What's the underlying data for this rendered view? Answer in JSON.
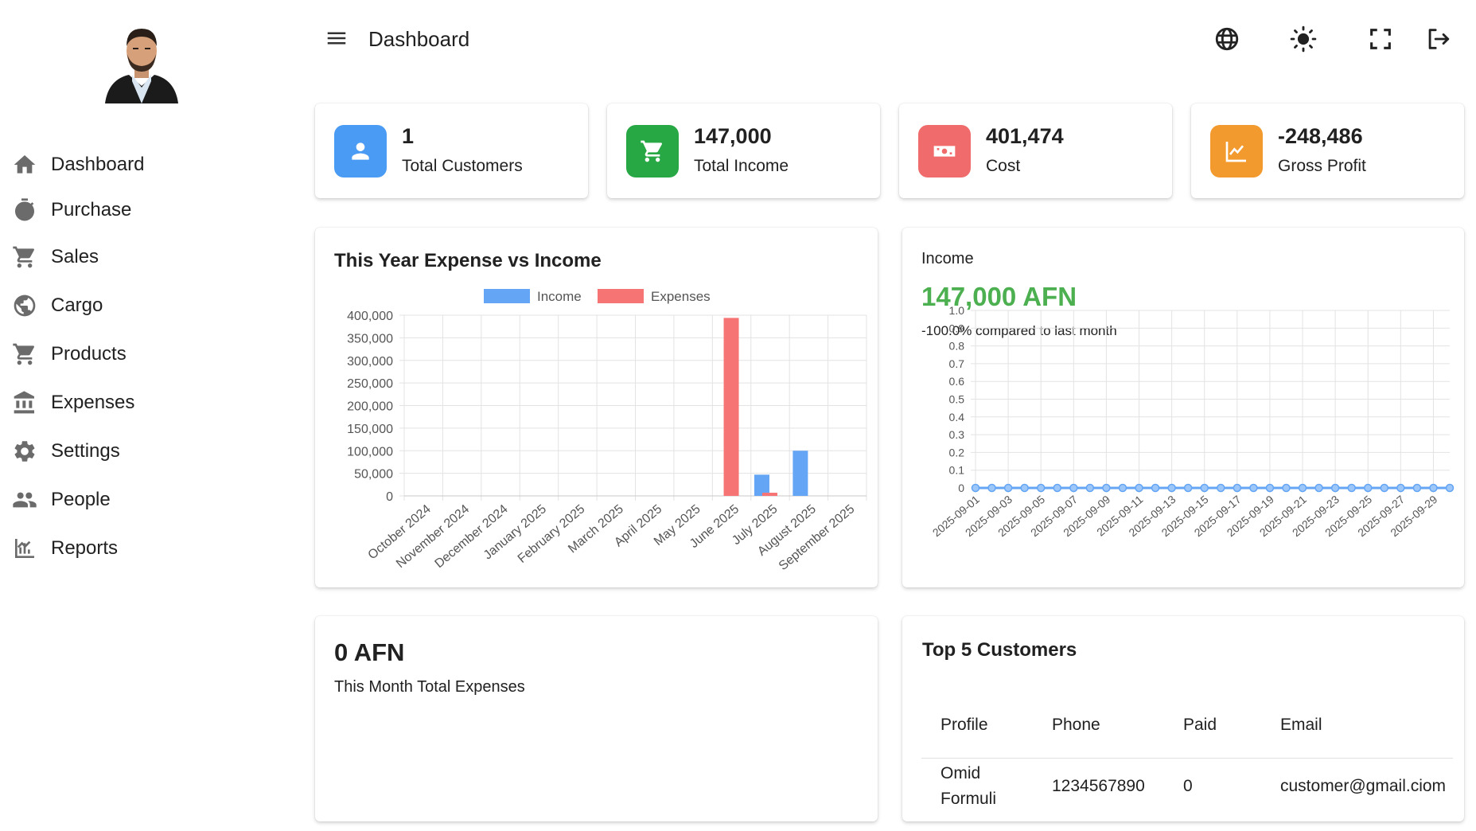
{
  "app": {
    "title": "Dashboard"
  },
  "sidebar": {
    "items": [
      {
        "label": "Dashboard",
        "icon": "home-icon"
      },
      {
        "label": "Purchase",
        "icon": "timer-icon"
      },
      {
        "label": "Sales",
        "icon": "cart-icon"
      },
      {
        "label": "Cargo",
        "icon": "globe-icon"
      },
      {
        "label": "Products",
        "icon": "cart-icon"
      },
      {
        "label": "Expenses",
        "icon": "bank-icon"
      },
      {
        "label": "Settings",
        "icon": "gear-icon"
      },
      {
        "label": "People",
        "icon": "people-icon"
      },
      {
        "label": "Reports",
        "icon": "chart-icon"
      }
    ]
  },
  "header": {
    "title": "Dashboard",
    "icons": [
      "language-icon",
      "theme-icon",
      "fullscreen-icon",
      "logout-icon"
    ]
  },
  "stats": [
    {
      "value": "1",
      "label": "Total Customers",
      "color": "#4a9bf3",
      "icon": "user-icon"
    },
    {
      "value": "147,000",
      "label": "Total Income",
      "color": "#28a745",
      "icon": "cart-icon"
    },
    {
      "value": "401,474",
      "label": "Cost",
      "color": "#f06b6b",
      "icon": "money-icon"
    },
    {
      "value": "-248,486",
      "label": "Gross Profit",
      "color": "#f39a2e",
      "icon": "trend-icon"
    }
  ],
  "expense_chart": {
    "title": "This Year Expense vs Income"
  },
  "income_panel": {
    "caption": "Income",
    "amount": "147,000 AFN",
    "compare": "-100.0% compared to last month"
  },
  "expenses_panel": {
    "amount": "0 AFN",
    "label": "This Month Total Expenses"
  },
  "customers": {
    "title": "Top 5 Customers",
    "columns": [
      "Profile",
      "Phone",
      "Paid",
      "Email"
    ],
    "rows": [
      {
        "profile_line1": "Omid",
        "profile_line2": "Formuli",
        "phone": "1234567890",
        "paid": "0",
        "email": "customer@gmail.ciom"
      }
    ]
  },
  "chart_data": [
    {
      "type": "bar",
      "title": "This Year Expense vs Income",
      "categories": [
        "October 2024",
        "November 2024",
        "December 2024",
        "January 2025",
        "February 2025",
        "March 2025",
        "April 2025",
        "May 2025",
        "June 2025",
        "July 2025",
        "August 2025",
        "September 2025"
      ],
      "series": [
        {
          "name": "Income",
          "color": "#64a5f5",
          "values": [
            0,
            0,
            0,
            0,
            0,
            0,
            0,
            0,
            0,
            47000,
            100000,
            0
          ]
        },
        {
          "name": "Expenses",
          "color": "#f77474",
          "values": [
            0,
            0,
            0,
            0,
            0,
            0,
            0,
            0,
            394000,
            7000,
            0,
            0
          ]
        }
      ],
      "ylim": [
        0,
        400000
      ],
      "yticks": [
        "0",
        "50,000",
        "100,000",
        "150,000",
        "200,000",
        "250,000",
        "300,000",
        "350,000",
        "400,000"
      ],
      "legend": "top",
      "grid": true
    },
    {
      "type": "line",
      "categories": [
        "2025-09-01",
        "2025-09-02",
        "2025-09-03",
        "2025-09-04",
        "2025-09-05",
        "2025-09-06",
        "2025-09-07",
        "2025-09-08",
        "2025-09-09",
        "2025-09-10",
        "2025-09-11",
        "2025-09-12",
        "2025-09-13",
        "2025-09-14",
        "2025-09-15",
        "2025-09-16",
        "2025-09-17",
        "2025-09-18",
        "2025-09-19",
        "2025-09-20",
        "2025-09-21",
        "2025-09-22",
        "2025-09-23",
        "2025-09-24",
        "2025-09-25",
        "2025-09-26",
        "2025-09-27",
        "2025-09-28",
        "2025-09-29",
        "2025-09-30"
      ],
      "tick_labels": [
        "2025-09-01",
        "2025-09-03",
        "2025-09-05",
        "2025-09-07",
        "2025-09-09",
        "2025-09-11",
        "2025-09-13",
        "2025-09-15",
        "2025-09-17",
        "2025-09-19",
        "2025-09-21",
        "2025-09-23",
        "2025-09-25",
        "2025-09-27",
        "2025-09-29"
      ],
      "series": [
        {
          "color": "#64a5f5",
          "values": [
            0,
            0,
            0,
            0,
            0,
            0,
            0,
            0,
            0,
            0,
            0,
            0,
            0,
            0,
            0,
            0,
            0,
            0,
            0,
            0,
            0,
            0,
            0,
            0,
            0,
            0,
            0,
            0,
            0,
            0
          ]
        }
      ],
      "ylim": [
        0,
        1.0
      ],
      "yticks": [
        "0",
        "0.1",
        "0.2",
        "0.3",
        "0.4",
        "0.5",
        "0.6",
        "0.7",
        "0.8",
        "0.9",
        "1.0"
      ],
      "grid": true
    }
  ]
}
